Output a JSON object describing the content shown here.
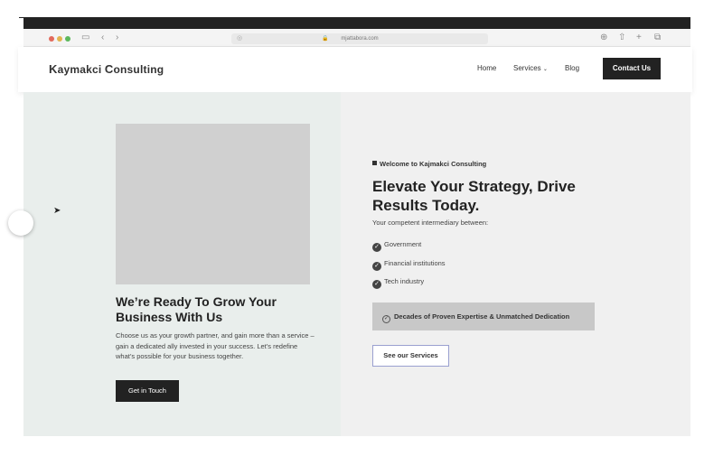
{
  "browser": {
    "url": "mjattabora.com"
  },
  "nav": {
    "logo_first": "K",
    "logo_rest1": "aymakci ",
    "logo_c": "C",
    "logo_rest2": "onsulting",
    "items": [
      {
        "label": "Home"
      },
      {
        "label": "Services"
      },
      {
        "label": "Blog"
      }
    ],
    "contact_label": "Contact Us"
  },
  "left": {
    "title": "We’re Ready To Grow Your Business With Us",
    "body": "Choose us as your growth partner, and gain more than a service – gain a dedicated ally invested in your success. Let’s redefine what’s possible for your business together.",
    "cta": "Get in Touch"
  },
  "right": {
    "welcome_prefix": "Welcome to ",
    "welcome_brand": "Kajmakci Consulting",
    "headline": "Elevate Your Strategy, Drive Results Today.",
    "sub": "Your competent intermediary between:",
    "list": [
      {
        "label": "Government"
      },
      {
        "label": "Financial institutions"
      },
      {
        "label": "Tech industry"
      }
    ],
    "expertise": "Decades of Proven Expertise & Unmatched Dedication",
    "services_btn": "See our Services"
  },
  "icons": {
    "check": "check-circle-icon",
    "expertise": "badge-check-icon",
    "cursor": "pointer-cursor-icon"
  }
}
